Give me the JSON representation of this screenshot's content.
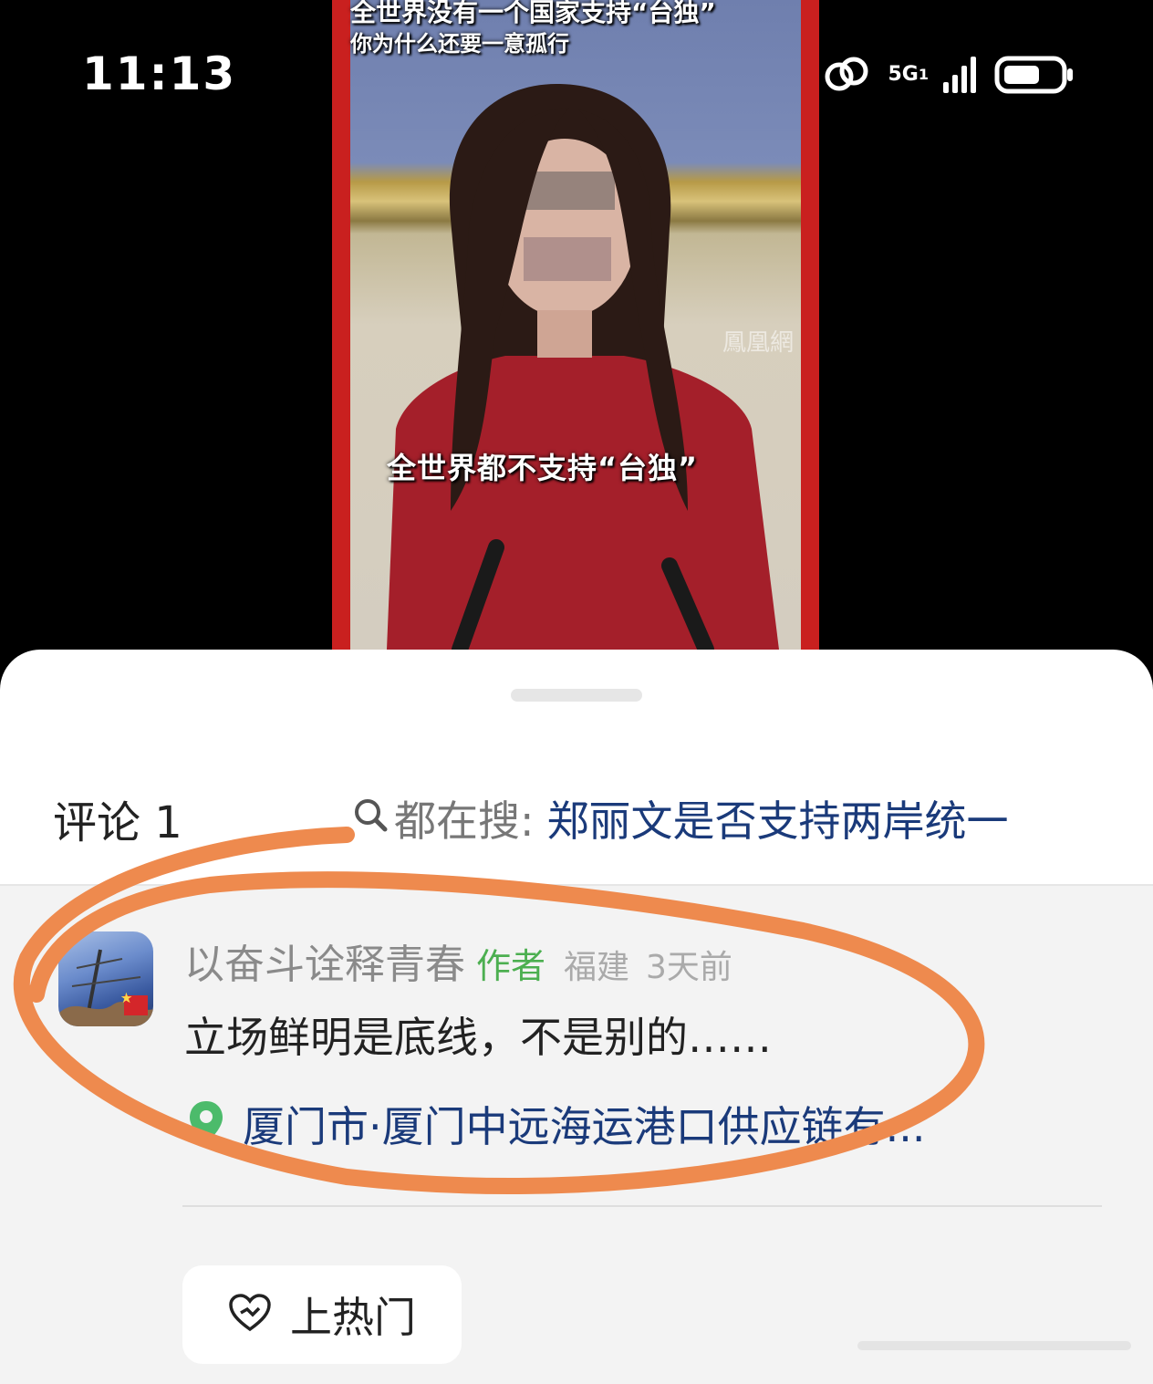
{
  "status_bar": {
    "time": "11:13",
    "network_label": "5G",
    "sim_index": "1",
    "icons": [
      "alarm-icon",
      "hotspot-link-icon",
      "signal-icon",
      "battery-icon"
    ]
  },
  "video": {
    "caption_top_line1": "全世界没有一个国家支持“台独”",
    "caption_top_line2": "你为什么还要一意孤行",
    "caption_middle": "全世界都不支持“台独”",
    "watermark": "鳳凰網"
  },
  "comments_panel": {
    "title": "评论 1",
    "search_prefix": "都在搜:",
    "search_query": "郑丽文是否支持两岸统一",
    "comment": {
      "author": "以奋斗诠释青春",
      "badge": "作者",
      "region": "福建",
      "time_ago": "3天前",
      "text": "立场鲜明是底线，不是别的……",
      "location": "厦门市·厦门中远海运港口供应链有..."
    },
    "hot_button_label": "上热门"
  },
  "colors": {
    "accent_link": "#1a3a7a",
    "author_badge": "#4caf50",
    "annotation_stroke": "#ee8a4e",
    "location_pin": "#4cbb6b"
  }
}
